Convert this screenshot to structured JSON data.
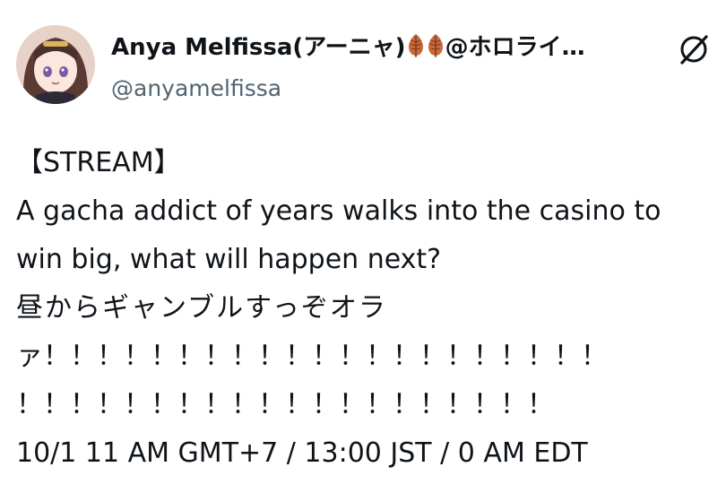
{
  "tweet_header": {
    "display_name": "Anya Melfissa(アーニャ)",
    "display_name_suffix": "@ホロライ…",
    "handle": "@anyamelfissa",
    "icons": [
      "leaf-icon",
      "leaf-icon",
      "grok-slash-icon"
    ]
  },
  "tweet_body": {
    "lines": [
      "【STREAM】",
      "A gacha addict of years walks into the casino to",
      "win big, what will happen next?",
      "昼からギャンブルすっぞオラ",
      "ァ！！！！！！！！！！！！！！！！！！！！！",
      "！！！！！！！！！！！！！！！！！！！！",
      "10/1 11 AM GMT+7 / 13:00 JST / 0 AM EDT"
    ]
  },
  "colors": {
    "text": "#0f1419",
    "secondary": "#536471",
    "leaf": "#c96a3d"
  }
}
